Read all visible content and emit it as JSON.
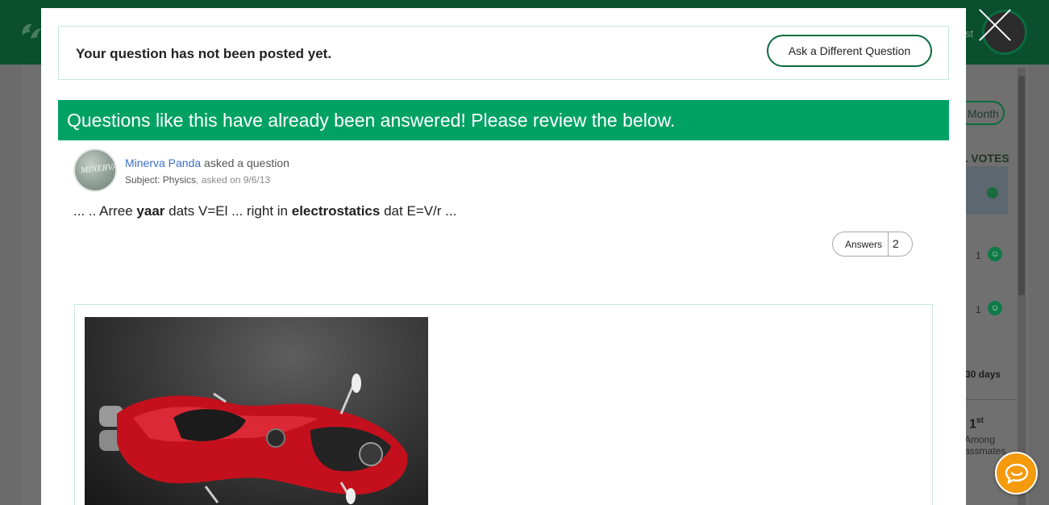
{
  "background": {
    "header_link": "st",
    "month_button": "Month",
    "votes_header": "L VOTES",
    "vote_rows": [
      {
        "count": "1"
      },
      {
        "count": "1"
      }
    ],
    "days_label": "30 days",
    "rank": "1",
    "rank_suffix": "st",
    "among_line1": "Among",
    "among_line2": "assmates"
  },
  "modal": {
    "notice_text": "Your question has not been posted yet.",
    "ask_different_label": "Ask a Different Question",
    "banner_text": "Questions like this have already been answered! Please review the below.",
    "question": {
      "author": "Minerva Panda",
      "action": " asked a question",
      "subject_label": "Subject: ",
      "subject": "Physics",
      "asked_on": ", asked on 9/6/13",
      "body_parts": [
        {
          "text": "... .. Arree ",
          "bold": false
        },
        {
          "text": "yaar",
          "bold": true
        },
        {
          "text": " dats V=El ... right in ",
          "bold": false
        },
        {
          "text": "electrostatics",
          "bold": true
        },
        {
          "text": " dat E=V/r ...",
          "bold": false
        }
      ],
      "answers_label": "Answers",
      "answers_count": "2"
    },
    "avatar_text": "MINERVA"
  },
  "colors": {
    "brand_green": "#00a264",
    "dark_green": "#0b6b3f",
    "link_blue": "#3d6fc4",
    "chat_orange": "#f59a0c"
  },
  "icons": {
    "close": "close-icon",
    "chat": "chat-bubble-icon",
    "smile": "smile-icon"
  }
}
